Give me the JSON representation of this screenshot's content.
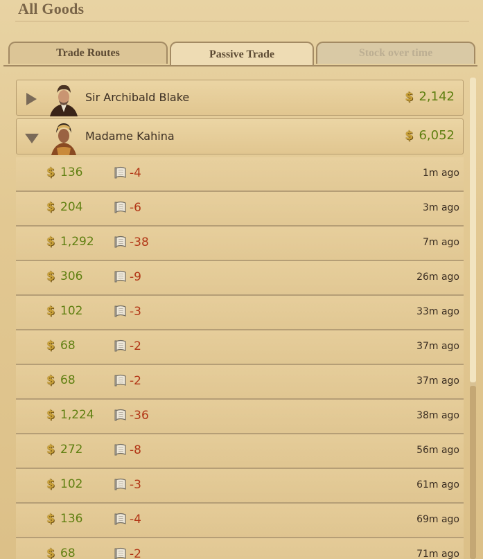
{
  "header": {
    "title": "All Goods"
  },
  "tabs": [
    {
      "label": "Trade Routes"
    },
    {
      "label": "Passive Trade"
    },
    {
      "label": "Stock over time"
    }
  ],
  "groups": [
    {
      "name": "Sir Archibald Blake",
      "total": "2,142",
      "expanded": false,
      "avatar": "merchant-portrait-icon"
    },
    {
      "name": "Madame Kahina",
      "total": "6,052",
      "expanded": true,
      "avatar": "merchant-portrait-icon"
    }
  ],
  "trades": [
    {
      "gold": "136",
      "goods": "-4",
      "time": "1m ago"
    },
    {
      "gold": "204",
      "goods": "-6",
      "time": "3m ago"
    },
    {
      "gold": "1,292",
      "goods": "-38",
      "time": "7m ago"
    },
    {
      "gold": "306",
      "goods": "-9",
      "time": "26m ago"
    },
    {
      "gold": "102",
      "goods": "-3",
      "time": "33m ago"
    },
    {
      "gold": "68",
      "goods": "-2",
      "time": "37m ago"
    },
    {
      "gold": "68",
      "goods": "-2",
      "time": "37m ago"
    },
    {
      "gold": "1,224",
      "goods": "-36",
      "time": "38m ago"
    },
    {
      "gold": "272",
      "goods": "-8",
      "time": "56m ago"
    },
    {
      "gold": "102",
      "goods": "-3",
      "time": "61m ago"
    },
    {
      "gold": "136",
      "goods": "-4",
      "time": "69m ago"
    },
    {
      "gold": "68",
      "goods": "-2",
      "time": "71m ago"
    }
  ],
  "icons": {
    "gold": "coin-icon",
    "goods": "cloth-scroll-icon"
  },
  "colors": {
    "gold_text": "#5f7f10",
    "goods_text": "#b23616"
  }
}
